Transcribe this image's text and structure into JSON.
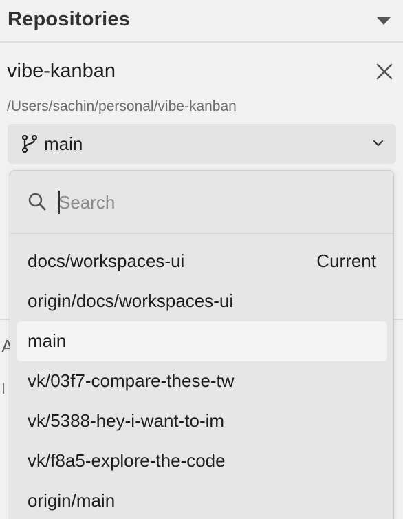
{
  "section": {
    "title": "Repositories",
    "caret_icon": "caret-down-icon"
  },
  "repo": {
    "name": "vibe-kanban",
    "path": "/Users/sachin/personal/vibe-kanban",
    "close_icon": "close-icon"
  },
  "branch_select": {
    "icon": "git-branch-icon",
    "selected": "main",
    "chevron_icon": "chevron-down-icon"
  },
  "background_fragments": {
    "a": "A",
    "b": "I"
  },
  "dropdown": {
    "search": {
      "placeholder": "Search",
      "value": "",
      "icon": "search-icon"
    },
    "items": [
      {
        "label": "docs/workspaces-ui",
        "tag": "Current",
        "active": false
      },
      {
        "label": "origin/docs/workspaces-ui",
        "tag": "",
        "active": false
      },
      {
        "label": "main",
        "tag": "",
        "active": true
      },
      {
        "label": "vk/03f7-compare-these-tw",
        "tag": "",
        "active": false
      },
      {
        "label": "vk/5388-hey-i-want-to-im",
        "tag": "",
        "active": false
      },
      {
        "label": "vk/f8a5-explore-the-code",
        "tag": "",
        "active": false
      },
      {
        "label": "origin/main",
        "tag": "",
        "active": false
      }
    ]
  },
  "colors": {
    "panel_bg": "#f1f1f1",
    "select_bg": "#e3e3e3",
    "dropdown_bg": "#e6e6e6",
    "active_item_bg": "#f4f4f4",
    "text": "#1e1e1e",
    "muted_text": "#6b6b6b"
  }
}
